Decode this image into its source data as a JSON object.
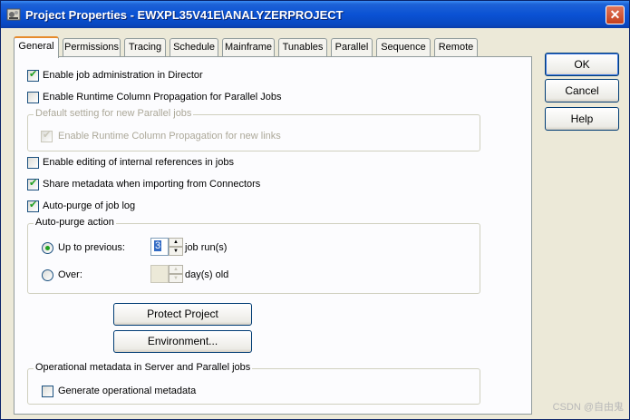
{
  "window": {
    "title": "Project Properties - EWXPL35V41E\\ANALYZERPROJECT",
    "close_glyph": "✕"
  },
  "tabs": [
    {
      "label": "General",
      "active": true
    },
    {
      "label": "Permissions",
      "active": false
    },
    {
      "label": "Tracing",
      "active": false
    },
    {
      "label": "Schedule",
      "active": false
    },
    {
      "label": "Mainframe",
      "active": false
    },
    {
      "label": "Tunables",
      "active": false
    },
    {
      "label": "Parallel",
      "active": false
    },
    {
      "label": "Sequence",
      "active": false
    },
    {
      "label": "Remote",
      "active": false
    }
  ],
  "general": {
    "enable_job_admin": {
      "label": "Enable job administration in Director",
      "checked": true
    },
    "enable_rcp": {
      "label": "Enable Runtime Column Propagation for Parallel Jobs",
      "checked": false
    },
    "default_parallel_group": {
      "title": "Default setting for new Parallel jobs",
      "enable_rcp_new_links": {
        "label": "Enable Runtime Column Propagation for new links",
        "checked": true,
        "disabled": true
      }
    },
    "enable_editing_refs": {
      "label": "Enable editing of internal references in jobs",
      "checked": false
    },
    "share_metadata": {
      "label": "Share metadata when importing from Connectors",
      "checked": true
    },
    "auto_purge": {
      "label": "Auto-purge of job log",
      "checked": true
    },
    "auto_purge_group": {
      "title": "Auto-purge action",
      "up_to_previous": {
        "label": "Up to previous:",
        "selected": true,
        "value": "3",
        "unit": "job run(s)"
      },
      "over": {
        "label": "Over:",
        "selected": false,
        "value": "",
        "unit": "day(s) old"
      }
    },
    "protect_project_button": "Protect Project",
    "environment_button": "Environment...",
    "operational_group": {
      "title": "Operational metadata in Server and Parallel jobs",
      "generate": {
        "label": "Generate operational metadata",
        "checked": false
      }
    }
  },
  "buttons": {
    "ok": "OK",
    "cancel": "Cancel",
    "help": "Help"
  },
  "spin_glyphs": {
    "up": "▲",
    "down": "▼"
  },
  "watermark": "CSDN @自由鬼",
  "colors": {
    "title_bar": "#0a52d4",
    "face": "#ece9d8",
    "tab_highlight": "#e68b2c"
  }
}
